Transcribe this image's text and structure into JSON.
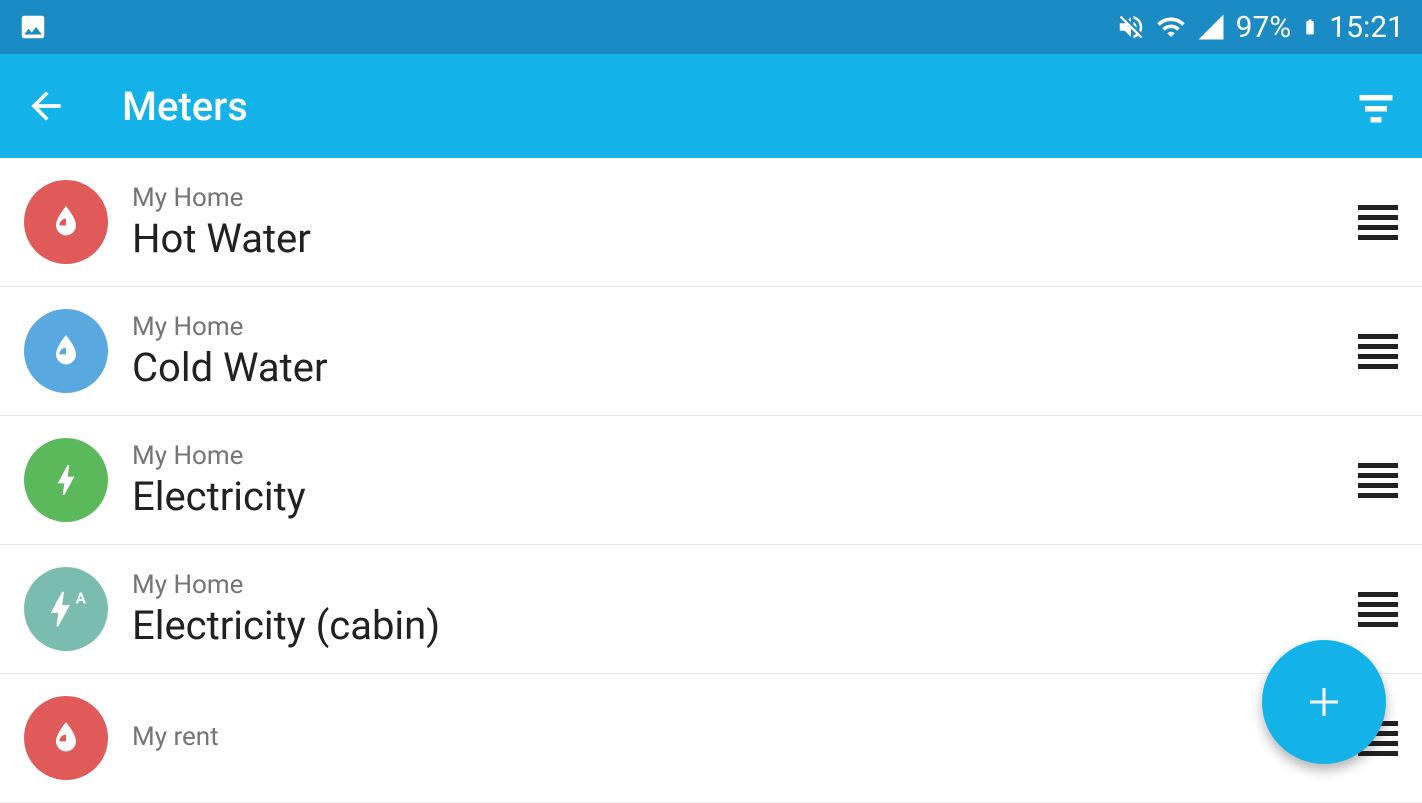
{
  "status": {
    "battery_pct": "97%",
    "time": "15:21"
  },
  "appbar": {
    "title": "Meters"
  },
  "meters": [
    {
      "location": "My Home",
      "name": "Hot Water",
      "icon": "water-drop",
      "color": "red"
    },
    {
      "location": "My Home",
      "name": "Cold Water",
      "icon": "water-drop",
      "color": "blue"
    },
    {
      "location": "My Home",
      "name": "Electricity",
      "icon": "bolt",
      "color": "green"
    },
    {
      "location": "My Home",
      "name": "Electricity (cabin)",
      "icon": "bolt-a",
      "color": "teal"
    },
    {
      "location": "My rent",
      "name": "",
      "icon": "water-drop",
      "color": "red"
    }
  ]
}
